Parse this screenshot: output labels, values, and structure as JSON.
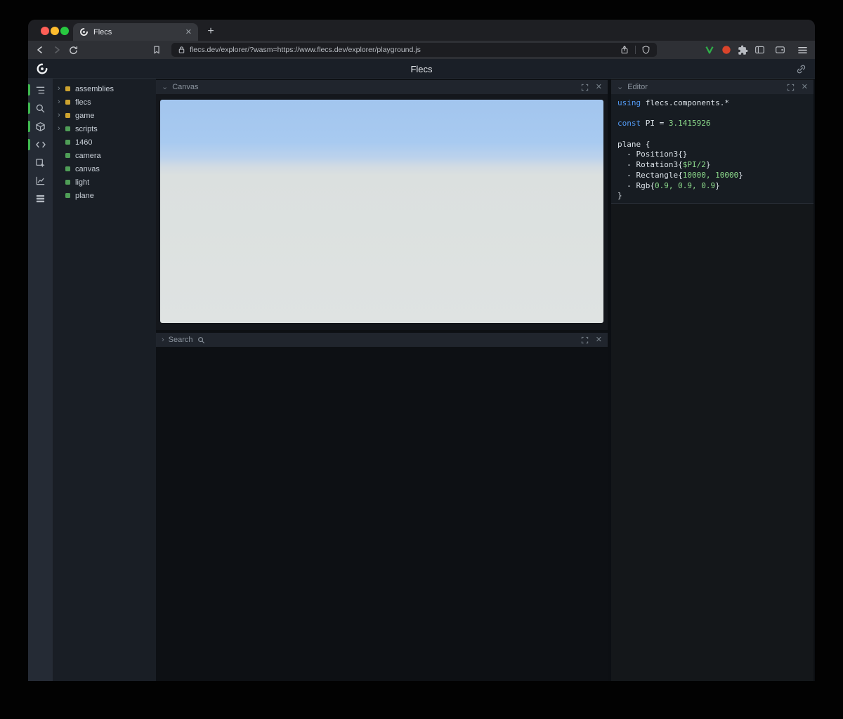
{
  "icons": {
    "close": "✕",
    "plus": "+",
    "chevron_down": "⌄",
    "chevron_right": "›"
  },
  "colors": {
    "traffic_close": "#ff5f57",
    "traffic_minimize": "#febc2e",
    "traffic_zoom": "#28c840",
    "active_indicator": "#3fb950",
    "module_yellow": "#cda32f",
    "entity_green": "#4f9e57",
    "keyword_blue": "#539bf5",
    "value_green": "#8ddb8c"
  },
  "browser": {
    "tab_title": "Flecs",
    "url": "flecs.dev/explorer/?wasm=https://www.flecs.dev/explorer/playground.js"
  },
  "app": {
    "title": "Flecs"
  },
  "left_toolbar": {
    "icons": [
      {
        "name": "entity-tree-icon",
        "active": true
      },
      {
        "name": "search-icon",
        "active": true
      },
      {
        "name": "cube-icon",
        "active": true
      },
      {
        "name": "code-icon",
        "active": true
      },
      {
        "name": "inspect-icon",
        "active": false
      },
      {
        "name": "chart-icon",
        "active": false
      },
      {
        "name": "rows-icon",
        "active": false
      }
    ]
  },
  "tree": {
    "items": [
      {
        "label": "assemblies",
        "color": "#cda32f",
        "expandable": true
      },
      {
        "label": "flecs",
        "color": "#cda32f",
        "expandable": true
      },
      {
        "label": "game",
        "color": "#cda32f",
        "expandable": true
      },
      {
        "label": "scripts",
        "color": "#4f9e57",
        "expandable": true
      },
      {
        "label": "1460",
        "color": "#4f9e57",
        "expandable": false
      },
      {
        "label": "camera",
        "color": "#4f9e57",
        "expandable": false
      },
      {
        "label": "canvas",
        "color": "#4f9e57",
        "expandable": false
      },
      {
        "label": "light",
        "color": "#4f9e57",
        "expandable": false
      },
      {
        "label": "plane",
        "color": "#4f9e57",
        "expandable": false
      }
    ]
  },
  "panels": {
    "canvas": {
      "title": "Canvas"
    },
    "search": {
      "title": "Search"
    },
    "editor": {
      "title": "Editor"
    }
  },
  "editor": {
    "lines": [
      [
        {
          "t": "kw",
          "s": "using "
        },
        {
          "t": "plain",
          "s": "flecs.components.*"
        }
      ],
      [],
      [
        {
          "t": "kw",
          "s": "const "
        },
        {
          "t": "plain",
          "s": "PI = "
        },
        {
          "t": "num",
          "s": "3.1415926"
        }
      ],
      [],
      [
        {
          "t": "plain",
          "s": "plane {"
        }
      ],
      [
        {
          "t": "plain",
          "s": "  - Position3{}"
        }
      ],
      [
        {
          "t": "plain",
          "s": "  - Rotation3{"
        },
        {
          "t": "num",
          "s": "$PI/2"
        },
        {
          "t": "plain",
          "s": "}"
        }
      ],
      [
        {
          "t": "plain",
          "s": "  - Rectangle{"
        },
        {
          "t": "num",
          "s": "10000, 10000"
        },
        {
          "t": "plain",
          "s": "}"
        }
      ],
      [
        {
          "t": "plain",
          "s": "  - Rgb{"
        },
        {
          "t": "num",
          "s": "0.9, 0.9, 0.9"
        },
        {
          "t": "plain",
          "s": "}"
        }
      ],
      [
        {
          "t": "plain",
          "s": "}"
        }
      ]
    ]
  }
}
